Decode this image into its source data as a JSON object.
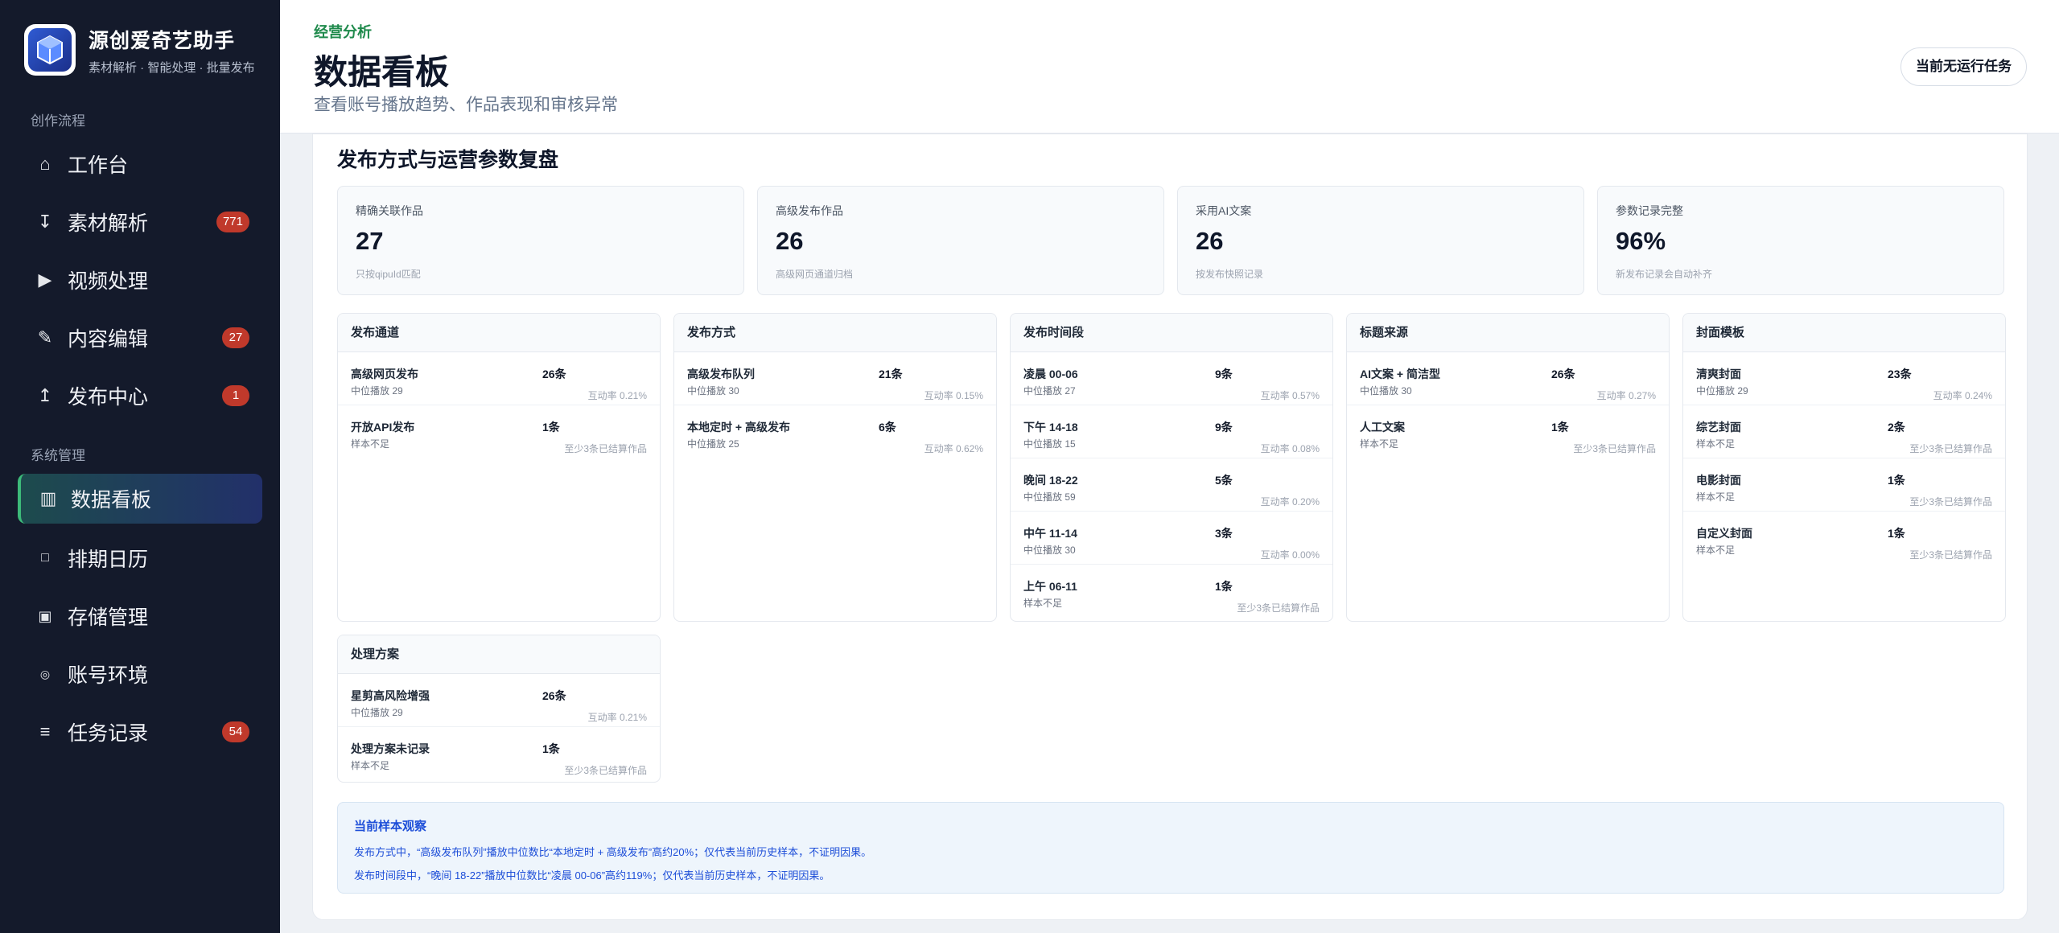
{
  "app": {
    "title": "源创爱奇艺助手",
    "subtitle": "素材解析 · 智能处理 · 批量发布"
  },
  "sidebar": {
    "section_workflow": "创作流程",
    "section_system": "系统管理",
    "items": [
      {
        "label": "工作台",
        "icon": "home-icon",
        "badge": ""
      },
      {
        "label": "素材解析",
        "icon": "download-icon",
        "badge": "771"
      },
      {
        "label": "视频处理",
        "icon": "play-icon",
        "badge": ""
      },
      {
        "label": "内容编辑",
        "icon": "pencil-icon",
        "badge": "27"
      },
      {
        "label": "发布中心",
        "icon": "upload-icon",
        "badge": "1"
      },
      {
        "label": "数据看板",
        "icon": "bar-chart-icon",
        "badge": ""
      },
      {
        "label": "排期日历",
        "icon": "calendar-icon",
        "badge": ""
      },
      {
        "label": "存储管理",
        "icon": "storage-icon",
        "badge": ""
      },
      {
        "label": "账号环境",
        "icon": "account-icon",
        "badge": ""
      },
      {
        "label": "任务记录",
        "icon": "list-icon",
        "badge": "54"
      }
    ],
    "active_index": 5
  },
  "header": {
    "eyebrow": "经营分析",
    "title": "数据看板",
    "subtitle": "查看账号播放趋势、作品表现和审核异常",
    "status": "当前无运行任务"
  },
  "review": {
    "title": "发布方式与运营参数复盘",
    "kpis": [
      {
        "label": "精确关联作品",
        "value": "27",
        "note": "只按qipuId匹配"
      },
      {
        "label": "高级发布作品",
        "value": "26",
        "note": "高级网页通道归档"
      },
      {
        "label": "采用AI文案",
        "value": "26",
        "note": "按发布快照记录"
      },
      {
        "label": "参数记录完整",
        "value": "96%",
        "note": "新发布记录会自动补齐"
      }
    ],
    "panels": [
      {
        "title": "发布通道",
        "rows": [
          {
            "name": "高级网页发布",
            "sub": "中位播放 29",
            "count": "26条",
            "meta": "互动率 0.21%"
          },
          {
            "name": "开放API发布",
            "sub": "样本不足",
            "count": "1条",
            "meta": "至少3条已结算作品"
          }
        ]
      },
      {
        "title": "发布方式",
        "rows": [
          {
            "name": "高级发布队列",
            "sub": "中位播放 30",
            "count": "21条",
            "meta": "互动率 0.15%"
          },
          {
            "name": "本地定时 + 高级发布",
            "sub": "中位播放 25",
            "count": "6条",
            "meta": "互动率 0.62%"
          }
        ]
      },
      {
        "title": "发布时间段",
        "rows": [
          {
            "name": "凌晨 00-06",
            "sub": "中位播放 27",
            "count": "9条",
            "meta": "互动率 0.57%"
          },
          {
            "name": "下午 14-18",
            "sub": "中位播放 15",
            "count": "9条",
            "meta": "互动率 0.08%"
          },
          {
            "name": "晚间 18-22",
            "sub": "中位播放 59",
            "count": "5条",
            "meta": "互动率 0.20%"
          },
          {
            "name": "中午 11-14",
            "sub": "中位播放 30",
            "count": "3条",
            "meta": "互动率 0.00%"
          },
          {
            "name": "上午 06-11",
            "sub": "样本不足",
            "count": "1条",
            "meta": "至少3条已结算作品"
          }
        ]
      },
      {
        "title": "标题来源",
        "rows": [
          {
            "name": "AI文案 + 简洁型",
            "sub": "中位播放 30",
            "count": "26条",
            "meta": "互动率 0.27%"
          },
          {
            "name": "人工文案",
            "sub": "样本不足",
            "count": "1条",
            "meta": "至少3条已结算作品"
          }
        ]
      },
      {
        "title": "封面模板",
        "rows": [
          {
            "name": "清爽封面",
            "sub": "中位播放 29",
            "count": "23条",
            "meta": "互动率 0.24%"
          },
          {
            "name": "综艺封面",
            "sub": "样本不足",
            "count": "2条",
            "meta": "至少3条已结算作品"
          },
          {
            "name": "电影封面",
            "sub": "样本不足",
            "count": "1条",
            "meta": "至少3条已结算作品"
          },
          {
            "name": "自定义封面",
            "sub": "样本不足",
            "count": "1条",
            "meta": "至少3条已结算作品"
          }
        ]
      },
      {
        "title": "处理方案",
        "rows": [
          {
            "name": "星剪高风险增强",
            "sub": "中位播放 29",
            "count": "26条",
            "meta": "互动率 0.21%"
          },
          {
            "name": "处理方案未记录",
            "sub": "样本不足",
            "count": "1条",
            "meta": "至少3条已结算作品"
          }
        ]
      }
    ],
    "observation": {
      "title": "当前样本观察",
      "lines": [
        "发布方式中，“高级发布队列”播放中位数比“本地定时 + 高级发布”高约20%；仅代表当前历史样本，不证明因果。",
        "发布时间段中，“晚间 18-22”播放中位数比“凌晨 00-06”高约119%；仅代表当前历史样本，不证明因果。"
      ]
    }
  }
}
